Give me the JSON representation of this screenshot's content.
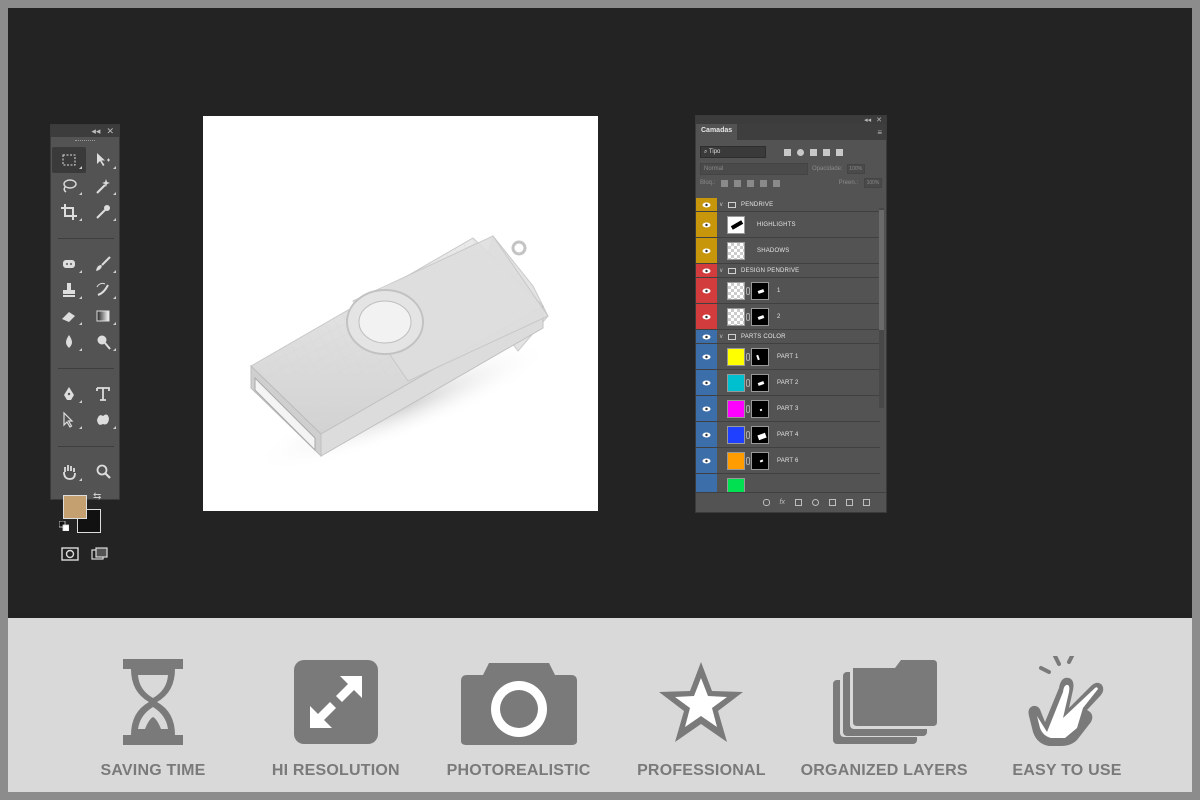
{
  "toolbox": {
    "tools": [
      "marquee-tool",
      "move-tool",
      "lasso-tool",
      "magic-wand-tool",
      "crop-tool",
      "eyedropper-tool",
      "spot-healing-tool",
      "brush-tool",
      "clone-stamp-tool",
      "history-brush-tool",
      "eraser-tool",
      "gradient-tool",
      "blur-tool",
      "dodge-tool",
      "pen-tool",
      "type-tool",
      "path-selection-tool",
      "shape-tool",
      "hand-tool",
      "zoom-tool"
    ],
    "foreground_color": "#c4a070",
    "background_color": "#111111"
  },
  "layers_panel": {
    "tab_label": "Camadas",
    "filter_label": "Tipo",
    "blend_mode": "Normal",
    "opacity_label": "Opacidade:",
    "opacity_value": "100%",
    "lock_label": "Bloq.:",
    "fill_label": "Preen.:",
    "fill_value": "100%",
    "groups": [
      {
        "name": "PENDRIVE",
        "color": "#c8960a",
        "layers": [
          {
            "name": "HIGHLIGHTS"
          },
          {
            "name": "SHADOWS"
          }
        ]
      },
      {
        "name": "DESIGN PENDRIVE",
        "color": "#d23c3c",
        "layers": [
          {
            "name": "1"
          },
          {
            "name": "2"
          }
        ]
      },
      {
        "name": "PARTS COLOR",
        "color": "#3c6eaa",
        "layers": [
          {
            "name": "PART 1",
            "swatch": "#ffff00"
          },
          {
            "name": "PART 2",
            "swatch": "#00c0d0"
          },
          {
            "name": "PART 3",
            "swatch": "#ff00ff"
          },
          {
            "name": "PART 4",
            "swatch": "#2040ff"
          },
          {
            "name": "PART 6",
            "swatch": "#ff9c00"
          }
        ]
      }
    ]
  },
  "features": [
    {
      "label": "SAVING TIME",
      "icon": "hourglass-icon"
    },
    {
      "label": "HI RESOLUTION",
      "icon": "expand-arrows-icon"
    },
    {
      "label": "PHOTOREALISTIC",
      "icon": "camera-icon"
    },
    {
      "label": "PROFESSIONAL",
      "icon": "star-icon"
    },
    {
      "label": "ORGANIZED LAYERS",
      "icon": "folders-icon"
    },
    {
      "label": "EASY TO USE",
      "icon": "hand-tap-icon"
    }
  ]
}
